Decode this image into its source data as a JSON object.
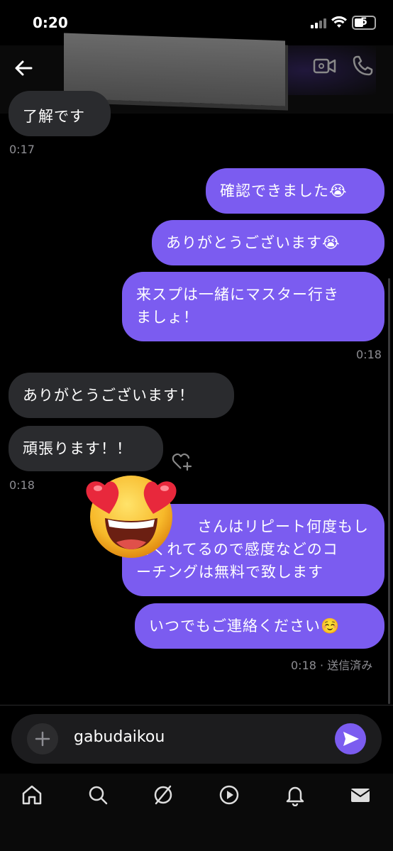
{
  "status_bar": {
    "time": "0:20",
    "battery": "5"
  },
  "header": {
    "back_icon": "arrow-left-icon",
    "video_icon": "video-camera-icon",
    "phone_icon": "phone-icon"
  },
  "messages": [
    {
      "dir": "in",
      "text": "了解です",
      "time": "0:17"
    },
    {
      "dir": "out",
      "text": "確認できました😭"
    },
    {
      "dir": "out",
      "text": "ありがとうございます😭"
    },
    {
      "dir": "out",
      "text": "来スプは一緒にマスター行き",
      "text2": "ましょ！",
      "time": "0:18"
    },
    {
      "dir": "in",
      "text": "ありがとうございます！"
    },
    {
      "dir": "in",
      "text": "頑張ります！！",
      "time": "0:18"
    },
    {
      "dir": "out",
      "text": "さんはリピート何度もし",
      "text2": "てくれてるので感度などのコ",
      "text3": "ーチングは無料で致します"
    },
    {
      "dir": "out",
      "text": "いつでもご連絡ください☺️",
      "time": "0:18 · 送信済み"
    }
  ],
  "reaction_emoji": "😍",
  "composer": {
    "value": "gabudaikou",
    "plus_icon": "plus-icon",
    "send_icon": "send-icon"
  },
  "nav": [
    "home-icon",
    "search-icon",
    "compass-icon",
    "play-icon",
    "bell-icon",
    "mail-icon"
  ]
}
